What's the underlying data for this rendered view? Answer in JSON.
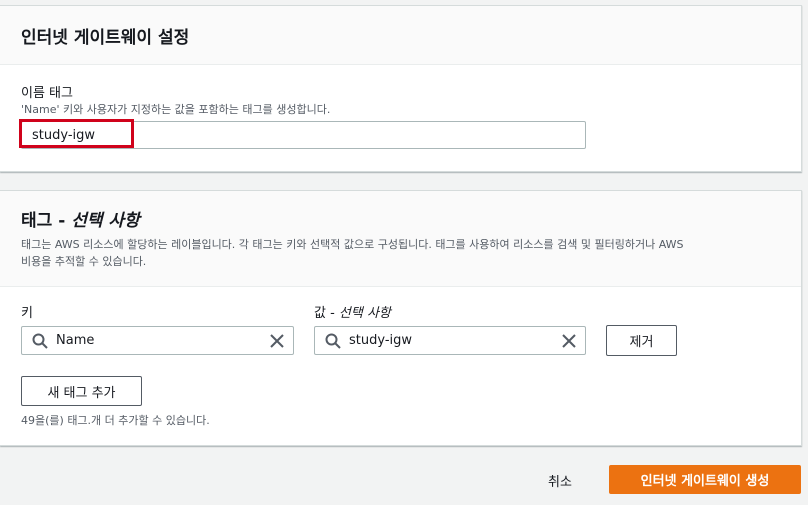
{
  "name_section": {
    "title": "인터넷 게이트웨이 설정",
    "label": "이름 태그",
    "description": "'Name' 키와 사용자가 지정하는 값을 포함하는 태그를 생성합니다.",
    "value": "study-igw",
    "highlight_color": "#d0021b"
  },
  "tags_section": {
    "title_main": "태그 - ",
    "title_italic": "선택 사항",
    "description_line1": "태그는 AWS 리소스에 할당하는 레이블입니다. 각 태그는 키와 선택적 값으로 구성됩니다. 태그를 사용하여 리소스를 검색 및 필터링하거나 AWS",
    "description_line2": "비용을 추적할 수 있습니다.",
    "key_label": "키",
    "value_label_main": "값 - ",
    "value_label_italic": "선택 사항",
    "tag": {
      "key": "Name",
      "value": "study-igw"
    },
    "remove_label": "제거",
    "add_label": "새 태그 추가",
    "remaining": "49을(를) 태그.개 더 추가할 수 있습니다."
  },
  "footer": {
    "cancel_label": "취소",
    "create_label": "인터넷 게이트웨이 생성",
    "primary_color": "#ec7211"
  }
}
